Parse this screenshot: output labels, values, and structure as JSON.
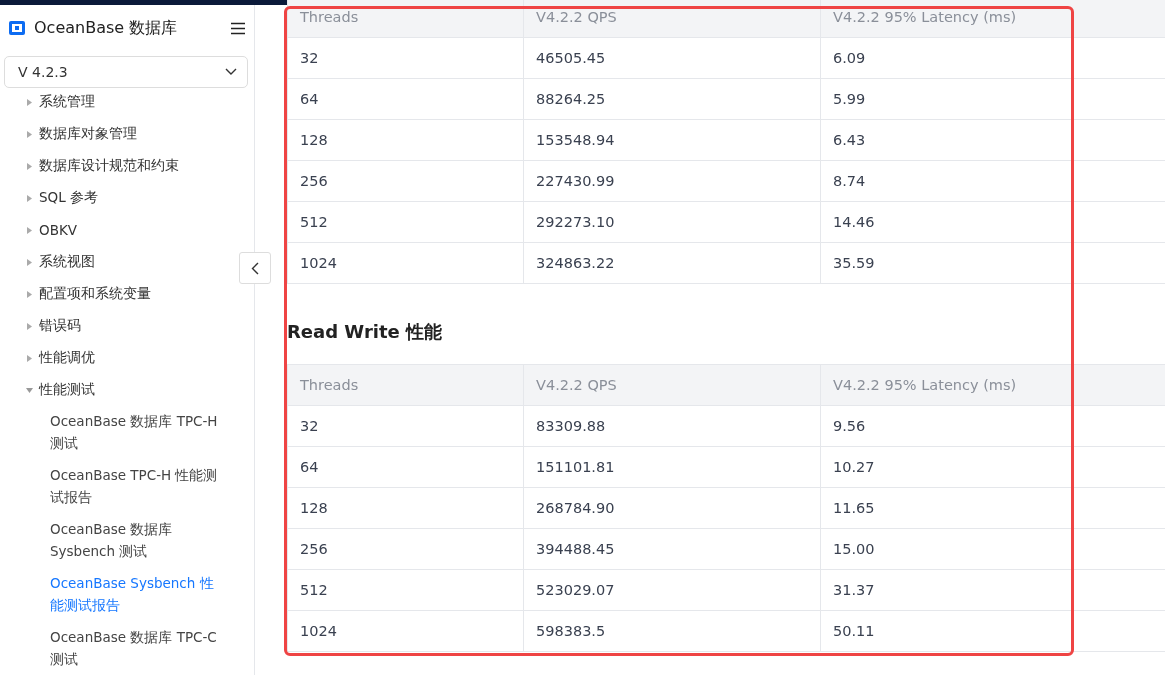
{
  "sidebar": {
    "brand": "OceanBase 数据库",
    "version": "V 4.2.3",
    "items": [
      {
        "label": "系统管理",
        "expanded": false
      },
      {
        "label": "数据库对象管理",
        "expanded": false
      },
      {
        "label": "数据库设计规范和约束",
        "expanded": false
      },
      {
        "label": "SQL 参考",
        "expanded": false
      },
      {
        "label": "OBKV",
        "expanded": false
      },
      {
        "label": "系统视图",
        "expanded": false
      },
      {
        "label": "配置项和系统变量",
        "expanded": false
      },
      {
        "label": "错误码",
        "expanded": false
      },
      {
        "label": "性能调优",
        "expanded": false
      },
      {
        "label": "性能测试",
        "expanded": true,
        "children": [
          {
            "label": "OceanBase 数据库 TPC-H 测试",
            "selected": false
          },
          {
            "label": "OceanBase TPC-H 性能测试报告",
            "selected": false
          },
          {
            "label": "OceanBase 数据库 Sysbench 测试",
            "selected": false
          },
          {
            "label": "OceanBase Sysbench 性能测试报告",
            "selected": true
          },
          {
            "label": "OceanBase 数据库 TPC-C 测试",
            "selected": false
          }
        ]
      }
    ]
  },
  "sections": [
    {
      "table": {
        "columns": [
          "Threads",
          "V4.2.2 QPS",
          "V4.2.2 95% Latency (ms)"
        ],
        "rows": [
          [
            "32",
            "46505.45",
            "6.09"
          ],
          [
            "64",
            "88264.25",
            "5.99"
          ],
          [
            "128",
            "153548.94",
            "6.43"
          ],
          [
            "256",
            "227430.99",
            "8.74"
          ],
          [
            "512",
            "292273.10",
            "14.46"
          ],
          [
            "1024",
            "324863.22",
            "35.59"
          ]
        ]
      }
    },
    {
      "heading": "Read Write 性能",
      "table": {
        "columns": [
          "Threads",
          "V4.2.2 QPS",
          "V4.2.2 95% Latency (ms)"
        ],
        "rows": [
          [
            "32",
            "83309.88",
            "9.56"
          ],
          [
            "64",
            "151101.81",
            "10.27"
          ],
          [
            "128",
            "268784.90",
            "11.65"
          ],
          [
            "256",
            "394488.45",
            "15.00"
          ],
          [
            "512",
            "523029.07",
            "31.37"
          ],
          [
            "1024",
            "598383.5",
            "50.11"
          ]
        ]
      }
    }
  ]
}
